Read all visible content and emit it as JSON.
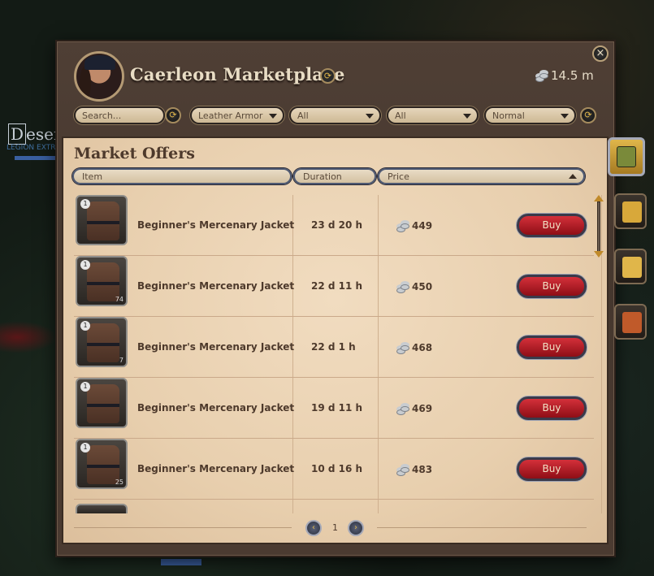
{
  "background": {
    "label": "Deserl",
    "sublabel": "LEGION EXTR"
  },
  "window": {
    "title": "Caerleon Marketplace",
    "silver_amount": "14.5 m",
    "close_label": "×",
    "info_label": "⟳"
  },
  "filters": {
    "search_placeholder": "Search...",
    "category": "Leather Armor",
    "tier": "All",
    "enchantment": "All",
    "quality": "Normal",
    "refresh_label": "⟳"
  },
  "market": {
    "heading": "Market Offers",
    "columns": {
      "item": "Item",
      "duration": "Duration",
      "price": "Price"
    },
    "buy_label": "Buy",
    "rows": [
      {
        "name": "Beginner's Mercenary Jacket",
        "duration": "23 d 20 h",
        "price": "449",
        "tier": "1",
        "qty": ""
      },
      {
        "name": "Beginner's Mercenary Jacket",
        "duration": "22 d 11 h",
        "price": "450",
        "tier": "1",
        "qty": "74"
      },
      {
        "name": "Beginner's Mercenary Jacket",
        "duration": "22 d 1 h",
        "price": "468",
        "tier": "1",
        "qty": "7"
      },
      {
        "name": "Beginner's Mercenary Jacket",
        "duration": "19 d 11 h",
        "price": "469",
        "tier": "1",
        "qty": ""
      },
      {
        "name": "Beginner's Mercenary Jacket",
        "duration": "10 d 16 h",
        "price": "483",
        "tier": "1",
        "qty": "25"
      }
    ]
  },
  "pagination": {
    "page": "1",
    "prev": "‹",
    "next": "›"
  },
  "side_tabs": [
    {
      "icon": "buy-tab-icon",
      "color": "#e0b64a"
    },
    {
      "icon": "sell-tab-icon",
      "color": "#c0392b"
    },
    {
      "icon": "orders-tab-icon",
      "color": "#d8a83a"
    },
    {
      "icon": "history-tab-icon",
      "color": "#4a8a3a"
    }
  ]
}
